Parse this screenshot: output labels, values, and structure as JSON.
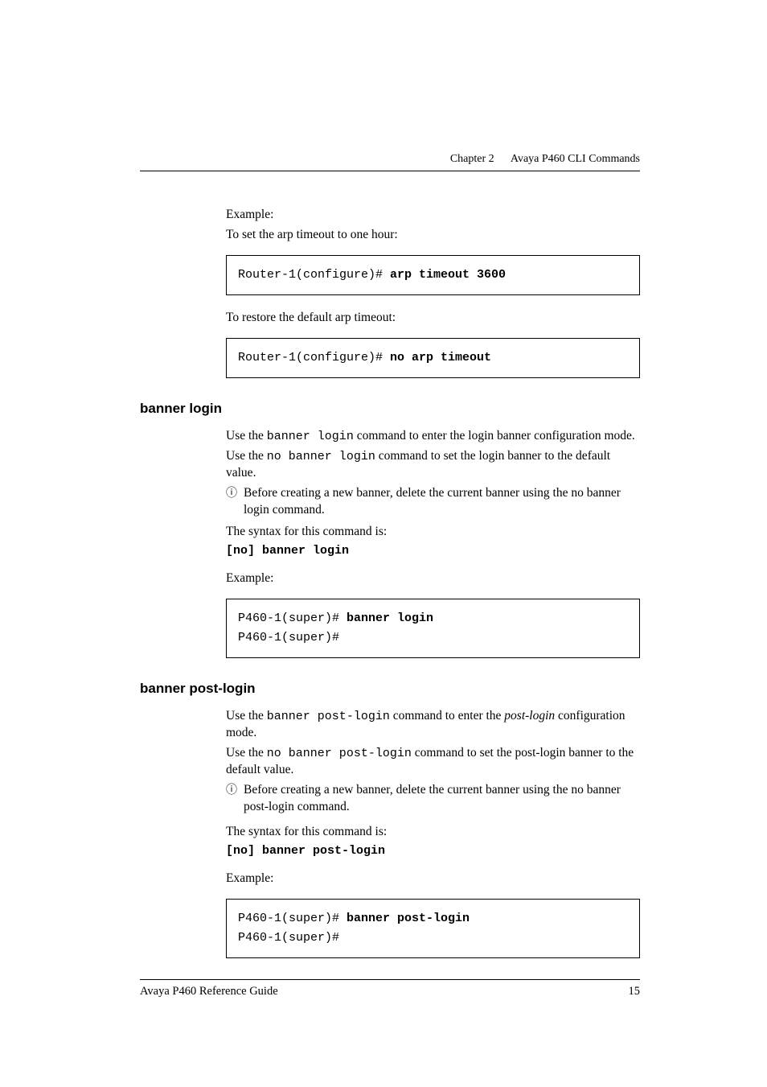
{
  "header": {
    "chapter": "Chapter 2",
    "title": "Avaya P460 CLI Commands"
  },
  "arp": {
    "example_label": "Example:",
    "example_desc": "To set the arp timeout to one hour:",
    "code1_prompt": "Router-1(configure)# ",
    "code1_cmd": "arp timeout 3600",
    "restore_desc": "To restore the default arp timeout:",
    "code2_prompt": "Router-1(configure)# ",
    "code2_cmd": "no arp timeout"
  },
  "banner_login": {
    "heading": "banner login",
    "use_prefix1": "Use the ",
    "cmd_mono1": "banner login",
    "use_suffix1": " command to enter the login banner configuration mode.",
    "use_prefix2": "Use the ",
    "cmd_mono2": "no banner login",
    "use_suffix2": " command to set the login banner to the default value.",
    "note_bullet": "ⓘ",
    "note_text": "Before creating a new banner, delete the current banner using the no banner login command.",
    "syntax_intro": "The syntax for this command is:",
    "syntax": "[no] banner login",
    "example_label": "Example:",
    "code_prompt": "P460-1(super)# ",
    "code_cmd": "banner login",
    "code_line2": "P460-1(super)#"
  },
  "banner_post_login": {
    "heading": "banner post-login",
    "use_prefix1": "Use the ",
    "cmd_mono1": "banner post-login",
    "use_suffix1a": " command to enter the ",
    "italic": "post-login",
    "use_suffix1b": " configuration mode.",
    "use_prefix2": "Use the ",
    "cmd_mono2": "no banner post-login",
    "use_suffix2": " command to set the post-login banner to the default value.",
    "note_bullet": "ⓘ",
    "note_text": "Before creating a new banner, delete the current banner using the no banner post-login command.",
    "syntax_intro": "The syntax for this command is:",
    "syntax": "[no] banner post-login",
    "example_label": "Example:",
    "code_prompt": "P460-1(super)# ",
    "code_cmd": "banner post-login",
    "code_line2": "P460-1(super)#"
  },
  "footer": {
    "left": "Avaya P460 Reference Guide",
    "right": "15"
  }
}
